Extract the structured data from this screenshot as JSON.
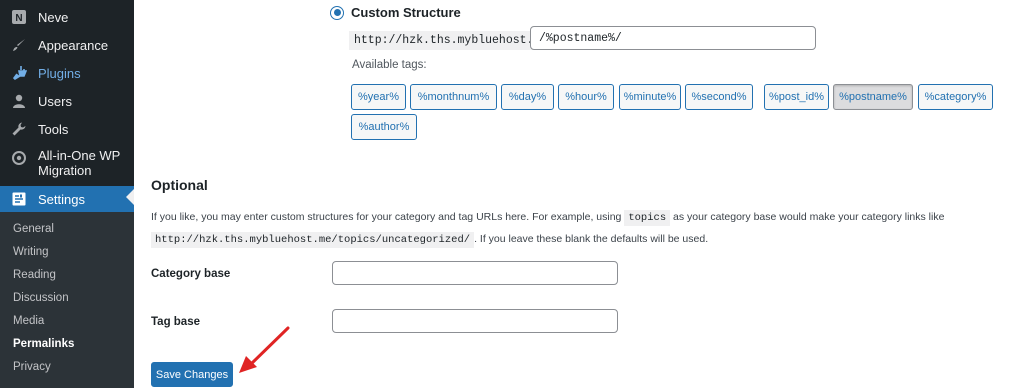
{
  "sidebar": {
    "items": [
      {
        "label": "Neve",
        "icon": "neve-logo-icon"
      },
      {
        "label": "Appearance",
        "icon": "paintbrush-icon"
      },
      {
        "label": "Plugins",
        "icon": "plugin-icon"
      },
      {
        "label": "Users",
        "icon": "user-icon"
      },
      {
        "label": "Tools",
        "icon": "wrench-icon"
      },
      {
        "label": "All-in-One WP Migration",
        "icon": "migration-icon"
      },
      {
        "label": "Settings",
        "icon": "settings-icon"
      }
    ],
    "submenu": [
      {
        "label": "General"
      },
      {
        "label": "Writing"
      },
      {
        "label": "Reading"
      },
      {
        "label": "Discussion"
      },
      {
        "label": "Media"
      },
      {
        "label": "Permalinks"
      },
      {
        "label": "Privacy"
      }
    ]
  },
  "permalink": {
    "custom_label": "Custom Structure",
    "base_url": "http://hzk.ths.mybluehost.me",
    "structure_value": "/%postname%/",
    "available_tags_label": "Available tags:",
    "tags": [
      "%year%",
      "%monthnum%",
      "%day%",
      "%hour%",
      "%minute%",
      "%second%",
      "%post_id%",
      "%postname%",
      "%category%",
      "%author%"
    ],
    "pressed_tag": "%postname%"
  },
  "optional": {
    "title": "Optional",
    "desc_part1": "If you like, you may enter custom structures for your category and tag URLs here. For example, using",
    "desc_code1": "topics",
    "desc_part2": "as your category base would make your category links like",
    "desc_code2": "http://hzk.ths.mybluehost.me/topics/uncategorized/",
    "desc_part3": ". If you leave these blank the defaults will be used.",
    "category_base_label": "Category base",
    "category_base_value": "",
    "tag_base_label": "Tag base",
    "tag_base_value": ""
  },
  "actions": {
    "save_label": "Save Changes"
  },
  "colors": {
    "sidebar_bg": "#1d2327",
    "accent": "#2271b1",
    "annotation_arrow": "#e02424"
  }
}
